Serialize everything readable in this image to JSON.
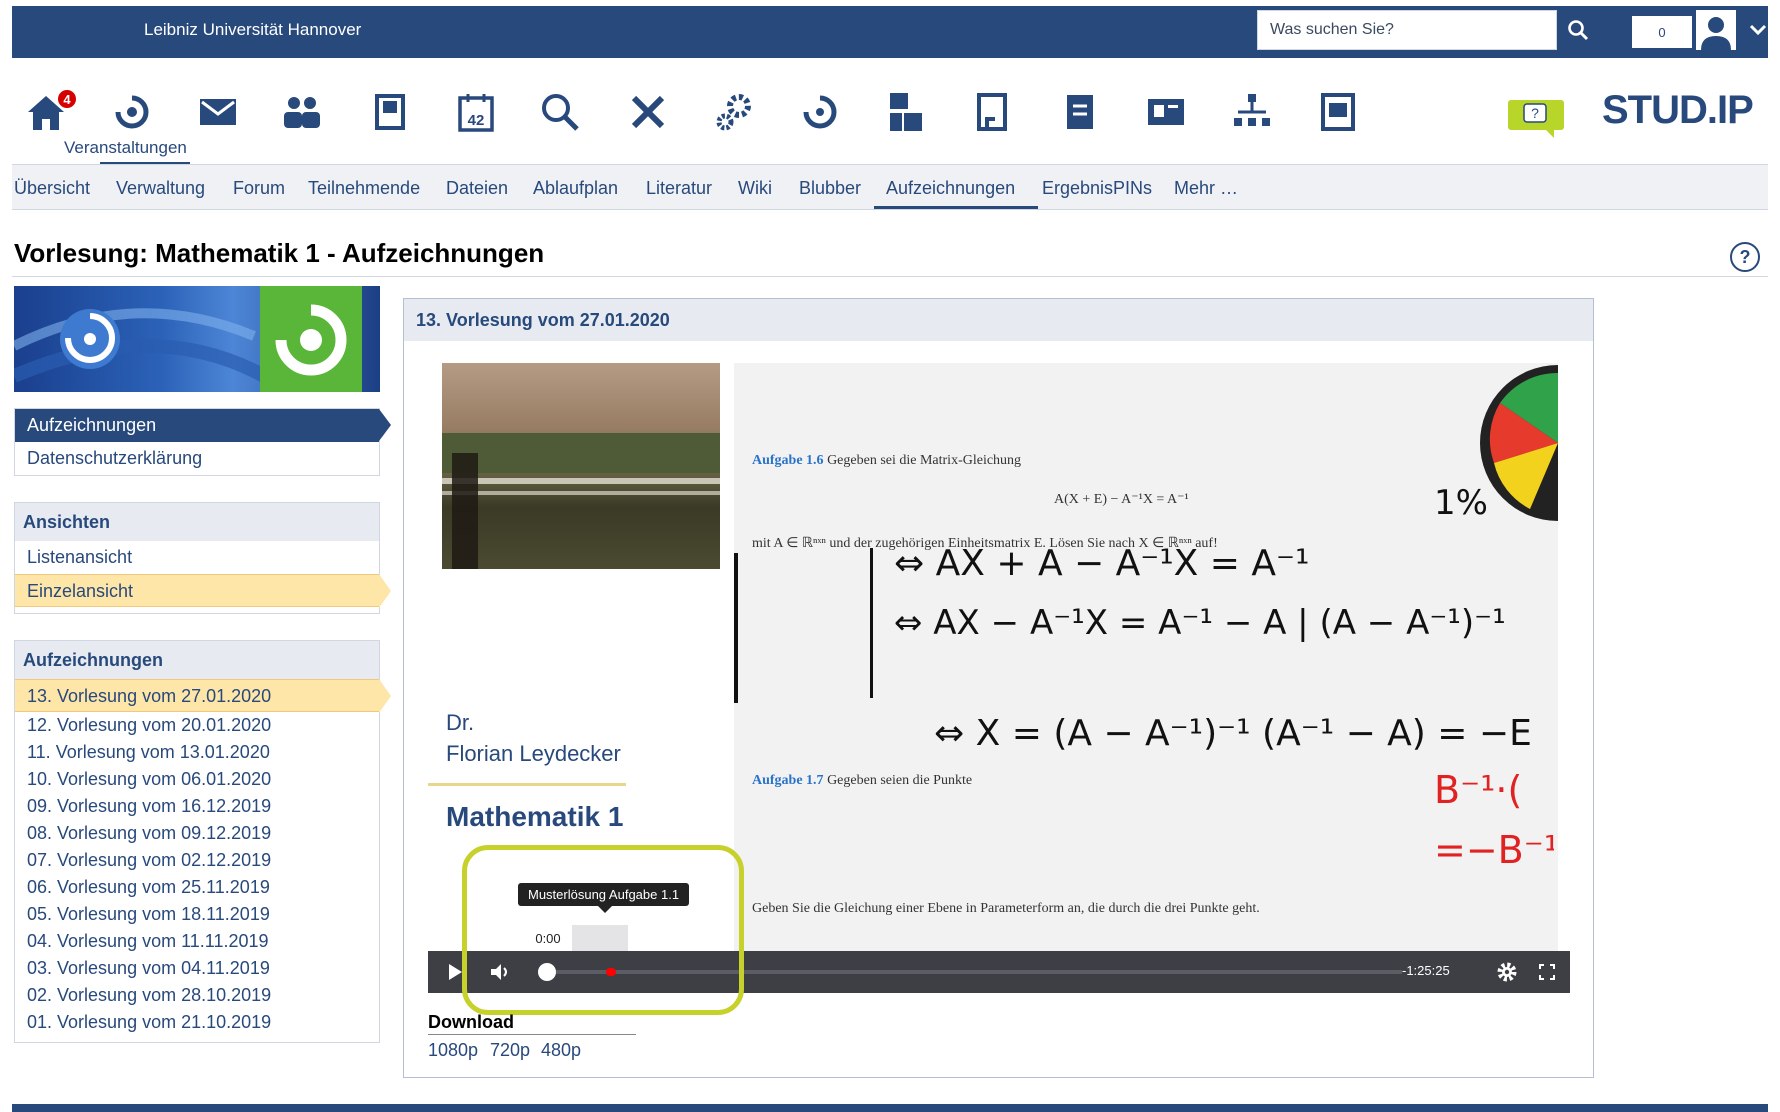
{
  "topbar": {
    "university": "Leibniz Universität Hannover",
    "search_placeholder": "Was suchen Sie?",
    "notification_count": "0"
  },
  "iconnav": {
    "badge_count": "4",
    "active_label": "Veranstaltungen",
    "calendar_day": "42",
    "icons": [
      "home-icon",
      "courses-icon",
      "mail-icon",
      "community-icon",
      "profile-icon",
      "calendar-icon",
      "search-icon",
      "tools-icon",
      "admin-icon",
      "opencast-icon",
      "evaluation-icon",
      "files-icon",
      "notes-icon",
      "news-icon",
      "hierarchy-icon",
      "schedule-icon"
    ]
  },
  "brand": {
    "logo_text": "STUD.IP"
  },
  "tabs": [
    "Übersicht",
    "Verwaltung",
    "Forum",
    "Teilnehmende",
    "Dateien",
    "Ablaufplan",
    "Literatur",
    "Wiki",
    "Blubber",
    "Aufzeichnungen",
    "ErgebnisPINs",
    "Mehr …"
  ],
  "page": {
    "title": "Vorlesung: Mathematik 1 - Aufzeichnungen",
    "help_symbol": "?"
  },
  "sidebar": {
    "nav": [
      "Aufzeichnungen",
      "Datenschutzerklärung"
    ],
    "views": {
      "heading": "Ansichten",
      "items": [
        "Listenansicht",
        "Einzelansicht"
      ]
    },
    "recordings": {
      "heading": "Aufzeichnungen",
      "items": [
        "13. Vorlesung vom 27.01.2020",
        "12. Vorlesung vom 20.01.2020",
        "11. Vorlesung vom 13.01.2020",
        "10. Vorlesung vom 06.01.2020",
        "09. Vorlesung vom 16.12.2019",
        "08. Vorlesung vom 09.12.2019",
        "07. Vorlesung vom 02.12.2019",
        "06. Vorlesung vom 25.11.2019",
        "05. Vorlesung vom 18.11.2019",
        "04. Vorlesung vom 11.11.2019",
        "03. Vorlesung vom 04.11.2019",
        "02. Vorlesung vom 28.10.2019",
        "01. Vorlesung vom 21.10.2019"
      ]
    }
  },
  "panel": {
    "title": "13. Vorlesung vom 27.01.2020",
    "lecturer_line1": "Dr.",
    "lecturer_line2": "Florian Leydecker",
    "course": "Mathematik 1",
    "slide": {
      "task1_label": "Aufgabe 1.6",
      "task1_text": "Gegeben sei die Matrix-Gleichung",
      "equation": "A(X + E) − A⁻¹X = A⁻¹",
      "task1_instruction": "mit A ∈ ℝⁿˣⁿ und der zugehörigen Einheitsmatrix E. Lösen Sie nach X ∈ ℝⁿˣⁿ auf!",
      "task2_label": "Aufgabe 1.7",
      "task2_text": "Gegeben seien die Punkte",
      "task2_instruction": "Geben Sie die Gleichung einer Ebene in Parameterform an, die durch die drei Punkte geht.",
      "handwriting_1": "⇔ AX + A − A⁻¹X = A⁻¹",
      "handwriting_2": "⇔ AX − A⁻¹X = A⁻¹ − A  | (A − A⁻¹)⁻¹",
      "handwriting_3": "⇔ X = (A − A⁻¹)⁻¹ (A⁻¹ − A) = −E",
      "handwriting_percent": "1%"
    },
    "player": {
      "tooltip": "Musterlösung Aufgabe 1.1",
      "current_time": "0:00",
      "remaining_time": "-1:25:25",
      "progress": 0
    },
    "download": {
      "heading": "Download",
      "qualities": [
        "1080p",
        "720p",
        "480p"
      ]
    }
  },
  "colors": {
    "brand_blue": "#28497c",
    "highlight_yellow": "#fee6a8",
    "annotation_outline": "#c7d12c",
    "badge_red": "#d60000"
  }
}
